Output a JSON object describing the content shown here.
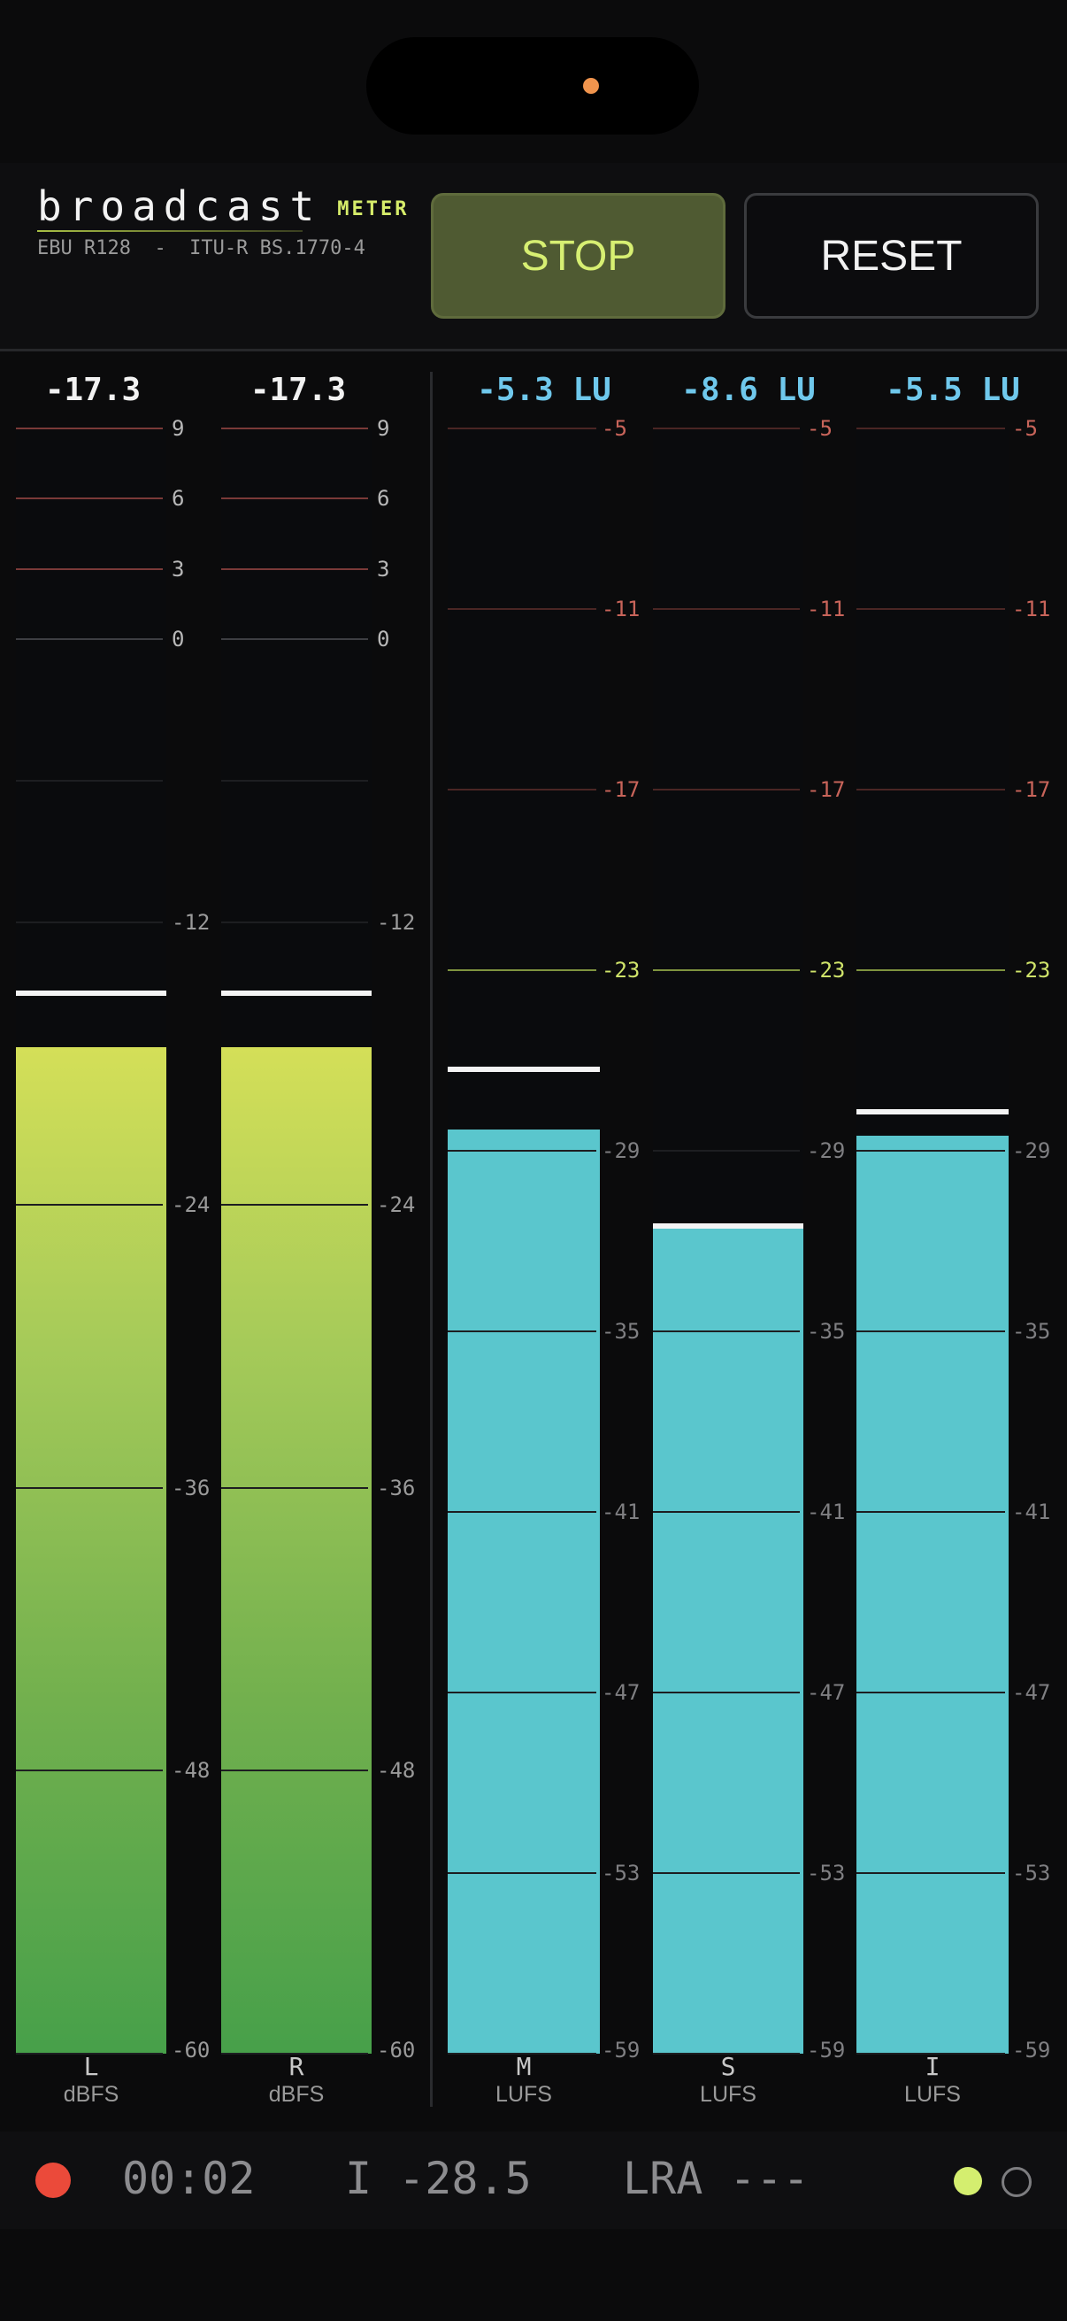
{
  "header": {
    "brand_name": "broadcast",
    "brand_tag": "METER",
    "subtitle": "EBU R128  -  ITU-R BS.1770-4",
    "stop_label": "STOP",
    "reset_label": "RESET"
  },
  "meters": {
    "peak_ticks": [
      "9",
      "6",
      "3",
      "0",
      "-12",
      "-24",
      "-36",
      "-48",
      "-60"
    ],
    "loudness_ticks": [
      "-5",
      "-11",
      "-17",
      "-23",
      "-29",
      "-35",
      "-41",
      "-47",
      "-53",
      "-59"
    ],
    "channels": [
      {
        "id": "L",
        "readout": "-17.3",
        "unit": "dBFS",
        "level_db": -17.3,
        "hold_db": -15.0,
        "scale": "peak"
      },
      {
        "id": "R",
        "readout": "-17.3",
        "unit": "dBFS",
        "level_db": -17.3,
        "hold_db": -15.0,
        "scale": "peak"
      },
      {
        "id": "M",
        "readout": "-5.3 LU",
        "unit": "LUFS",
        "level_lufs": -28.3,
        "hold_lufs": -26.3,
        "scale": "loudness"
      },
      {
        "id": "S",
        "readout": "-8.6 LU",
        "unit": "LUFS",
        "level_lufs": -31.6,
        "hold_lufs": -31.5,
        "scale": "loudness"
      },
      {
        "id": "I",
        "readout": "-5.5 LU",
        "unit": "LUFS",
        "level_lufs": -28.5,
        "hold_lufs": -27.7,
        "scale": "loudness"
      }
    ]
  },
  "footer": {
    "time": "00:02",
    "integrated": "I -28.5",
    "lra": "LRA ---"
  },
  "colors": {
    "accent": "#d7ef72",
    "loudness_fill": "#5ac6cd",
    "lu_readout": "#6fc8ec",
    "record": "#eb4a3a"
  }
}
